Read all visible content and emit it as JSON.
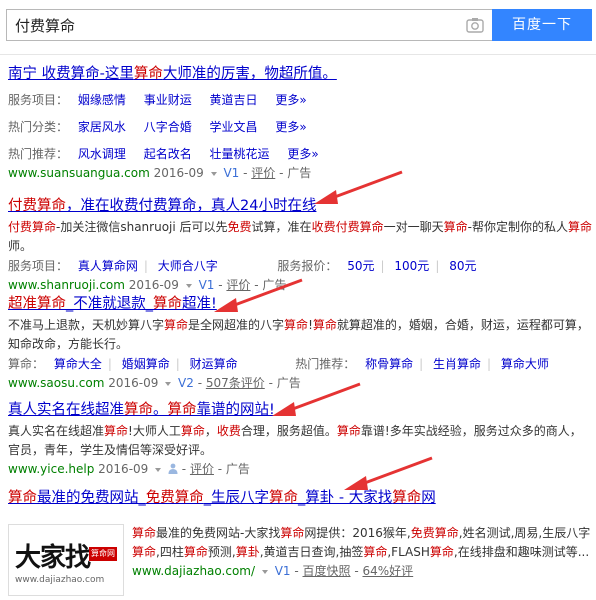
{
  "search": {
    "query": "付费算命",
    "button_label": "百度一下"
  },
  "results": [
    {
      "title_pre": "南宁 收费算命-这里",
      "title_em": "算命",
      "title_post": "大师准的厉害，物超所值。",
      "row1_label": "服务项目：",
      "row1_links": [
        "姻缘感情",
        "事业财运",
        "黄道吉日",
        "更多»"
      ],
      "row2_label": "热门分类：",
      "row2_links": [
        "家居风水",
        "八字合婚",
        "学业文昌",
        "更多»"
      ],
      "row3_label": "热门推荐：",
      "row3_links": [
        "风水调理",
        "起名改名",
        "壮量桃花运",
        "更多»"
      ],
      "url": "www.suansuangua.com",
      "date": "2016-09",
      "badge": "V1",
      "eval": "评价",
      "ad": "广告"
    },
    {
      "title_a": "付费算命",
      "title_b": "，准在收费付费算命，真人24小时在线",
      "snip_a1": "付费算命",
      "snip_b1": "-加关注微信shanruoji 后可以先",
      "snip_a2": "免费",
      "snip_b2": "试算，准在",
      "snip_a3": "收费付费算命",
      "snip_b3": "一对一聊天",
      "snip_a4": "算命",
      "snip_b4": "-帮你定制你的私人",
      "snip_a5": "算命",
      "snip_b5": "师。",
      "row_label": "服务项目：",
      "row_links": [
        "真人算命网",
        "大师合八字"
      ],
      "row_label2": "服务报价：",
      "row_prices": [
        "50元",
        "100元",
        "80元"
      ],
      "url": "www.shanruoji.com",
      "date": "2016-09",
      "badge": "V1",
      "eval": "评价",
      "ad": "广告"
    },
    {
      "title_a": "超准算命",
      "title_b": "_不准就退款_",
      "title_c": "算命",
      "title_d": "超准!",
      "snip_1": "不准马上退款，天机妙算八字",
      "snip_2": "算命",
      "snip_3": "是全网超准的八字",
      "snip_4": "算命",
      "snip_5": "!",
      "snip_6": "算命",
      "snip_7": "就算超准的，婚姻，合婚，财运，运程都可算，知命改命，方能长行。",
      "row_label": "算命：",
      "row_links": [
        "算命大全",
        "婚姻算命",
        "财运算命"
      ],
      "row_label2": "热门推荐：",
      "row_links2": [
        "称骨算命",
        "生肖算命",
        "算命大师"
      ],
      "url": "www.saosu.com",
      "date": "2016-09",
      "badge": "V2",
      "eval": "507条评价",
      "ad": "广告"
    },
    {
      "title_a": "真人实名在线超准",
      "title_b": "算命",
      "title_c": "。",
      "title_d": "算命",
      "title_e": "靠谱的网站!",
      "snip_1": "真人实名在线超准",
      "snip_2": "算命",
      "snip_3": "!大师人工",
      "snip_4": "算命",
      "snip_5": "，",
      "snip_6": "收费",
      "snip_7": "合理，服务超值。",
      "snip_8": "算命",
      "snip_9": "靠谱!多年实战经验，服务过众多的商人，官员，青年，学生及情侣等深受好评。",
      "url": "www.yice.help",
      "date": "2016-09",
      "eval": "评价",
      "ad": "广告"
    },
    {
      "title_a": "算命",
      "title_b": "最准的免费网站_",
      "title_c": "免费算命",
      "title_d": "_生辰八字",
      "title_e": "算命",
      "title_f": "_算卦 - 大家找",
      "title_g": "算命",
      "title_h": "网",
      "logo_main": "大家找",
      "logo_red": "算命网",
      "logo_sub": "www.dajiazhao.com",
      "snip_1": "算命",
      "snip_2": "最准的免费网站-大家找",
      "snip_3": "算命",
      "snip_4": "网提供：2016猴年,",
      "snip_5": "免费算命",
      "snip_6": ",姓名测试,周易,生辰八字",
      "snip_7": "算命",
      "snip_8": ",四柱",
      "snip_9": "算命",
      "snip_10": "预测,",
      "snip_11": "算卦",
      "snip_12": ",黄道吉日查询,抽签",
      "snip_13": "算命",
      "snip_14": ",FLASH",
      "snip_15": "算命",
      "snip_16": ",在线排盘和趣味测试等...",
      "url": "www.dajiazhao.com/",
      "badge": "V1",
      "snapshot": "百度快照",
      "rating": "64%好评"
    }
  ],
  "colors": {
    "accent": "#3385ff",
    "title_link": "#0000cc",
    "highlight": "#cc0000",
    "url": "#008000",
    "arrow": "#e53333"
  }
}
